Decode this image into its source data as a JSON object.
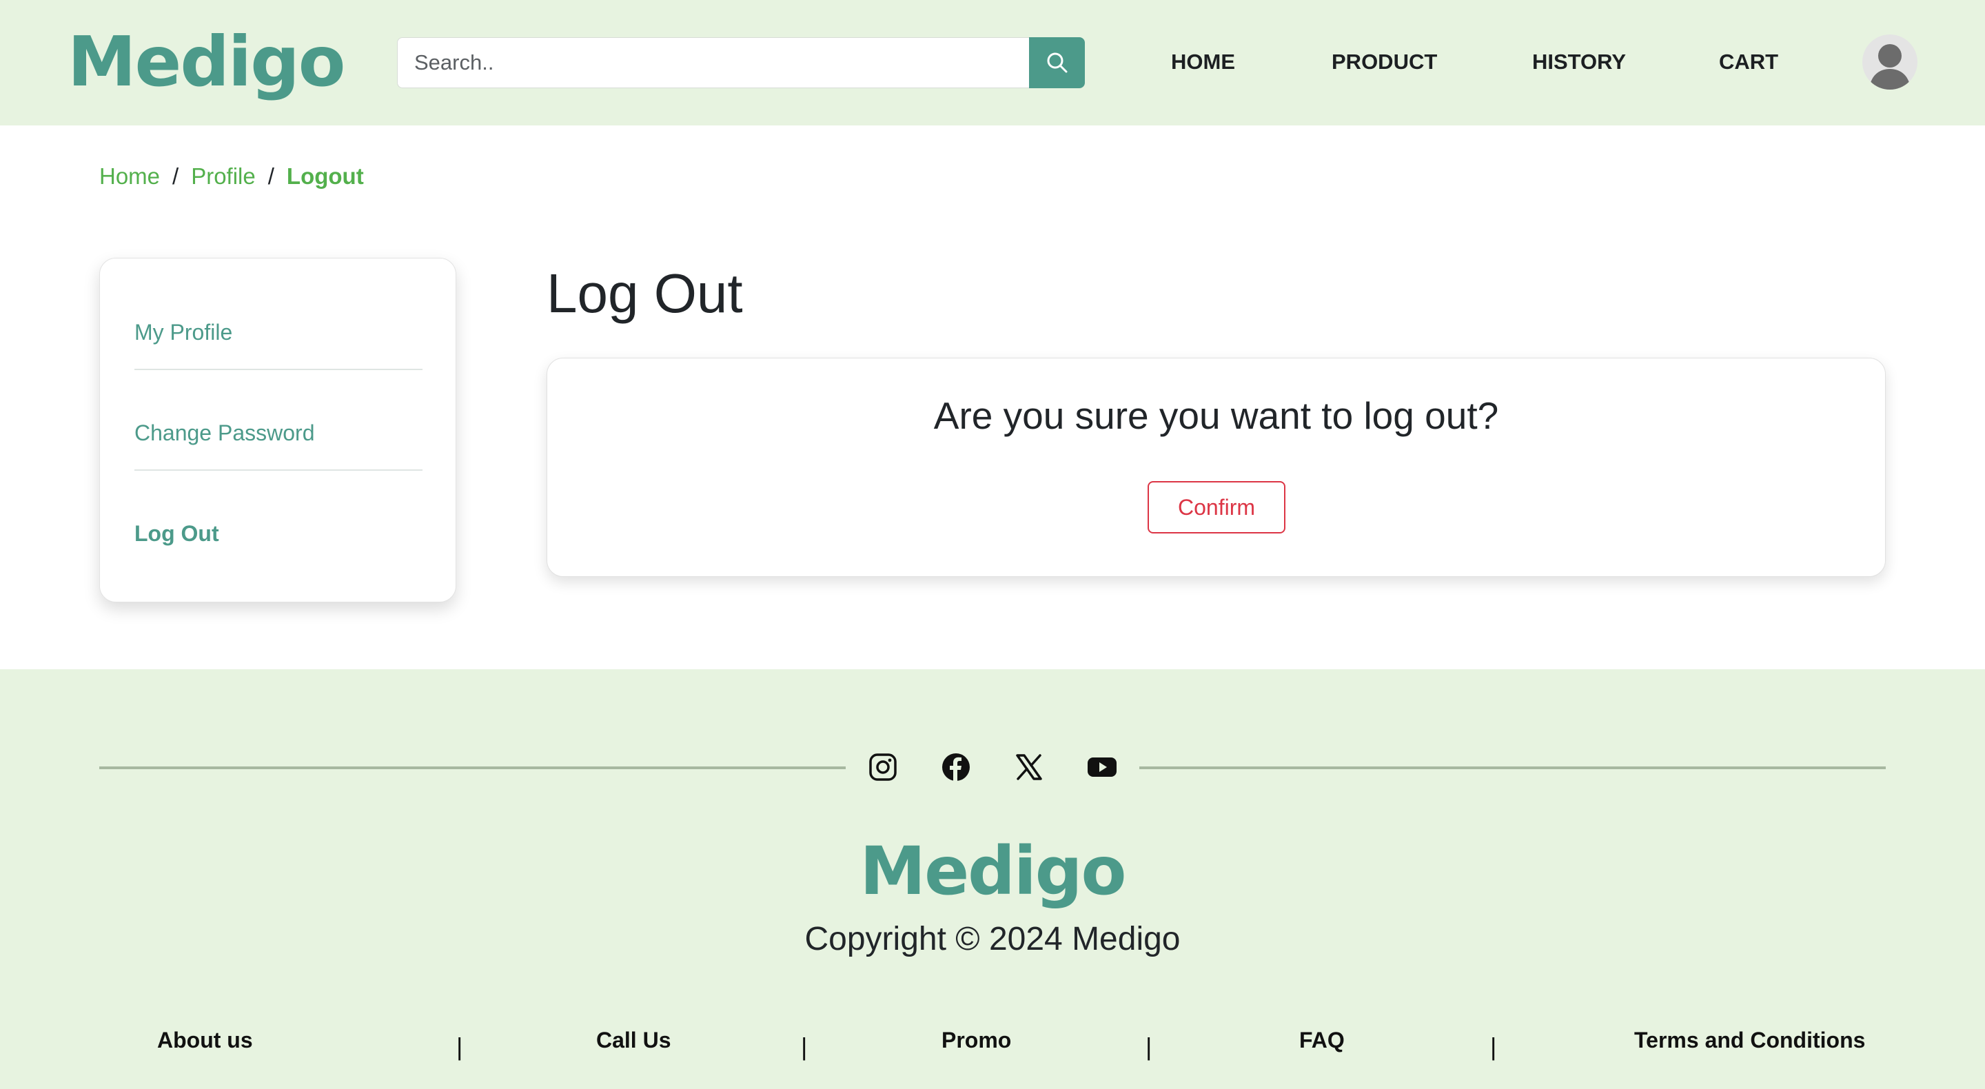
{
  "header": {
    "logo": "Medigo",
    "search": {
      "placeholder": "Search..",
      "value": ""
    },
    "nav": [
      "HOME",
      "PRODUCT",
      "HISTORY",
      "CART"
    ]
  },
  "breadcrumb": {
    "home": "Home",
    "separator": "/",
    "profile": "Profile",
    "current": "Logout"
  },
  "sidebar": {
    "items": [
      "My Profile",
      "Change Password",
      "Log Out"
    ]
  },
  "main": {
    "title": "Log Out",
    "question": "Are you sure you want to log out?",
    "confirm_label": "Confirm"
  },
  "footer": {
    "social_icons": [
      "instagram-icon",
      "facebook-icon",
      "x-icon",
      "youtube-icon"
    ],
    "logo": "Medigo",
    "copyright": "Copyright © 2024 Medigo",
    "links": [
      "About us",
      "Call Us",
      "Promo",
      "FAQ",
      "Terms and Conditions"
    ],
    "separator": "|"
  },
  "colors": {
    "brand": "#4c9a8a",
    "header_bg": "#e7f3e0",
    "breadcrumb": "#53b04c",
    "danger": "#dc3545"
  }
}
